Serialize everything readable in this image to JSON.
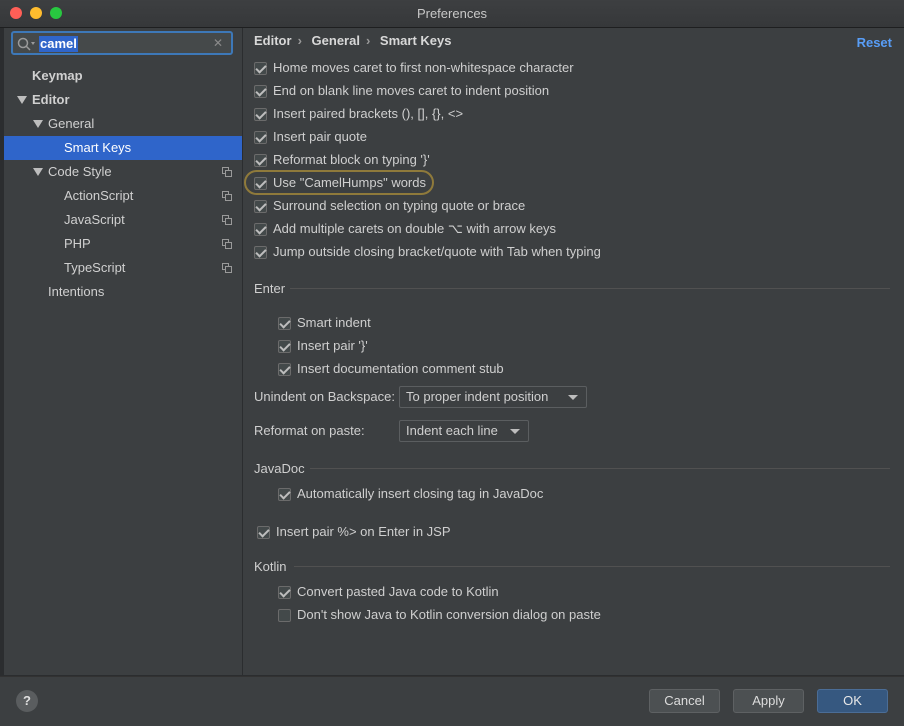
{
  "window": {
    "title": "Preferences",
    "colors": {
      "close": "#ff5f57",
      "minimize": "#febc2e",
      "zoom": "#28c840"
    }
  },
  "search": {
    "value": "camel"
  },
  "sidebar": {
    "items": [
      {
        "label": "Keymap"
      },
      {
        "label": "Editor"
      },
      {
        "label": "General"
      },
      {
        "label": "Smart Keys"
      },
      {
        "label": "Code Style"
      },
      {
        "label": "ActionScript"
      },
      {
        "label": "JavaScript"
      },
      {
        "label": "PHP"
      },
      {
        "label": "TypeScript"
      },
      {
        "label": "Intentions"
      }
    ]
  },
  "breadcrumb": {
    "items": [
      "Editor",
      "General",
      "Smart Keys"
    ],
    "separator": "›"
  },
  "reset_label": "Reset",
  "options": [
    {
      "label": "Home moves caret to first non-whitespace character",
      "checked": true
    },
    {
      "label": "End on blank line moves caret to indent position",
      "checked": true
    },
    {
      "label": "Insert paired brackets (), [], {}, <>",
      "checked": true
    },
    {
      "label": "Insert pair quote",
      "checked": true
    },
    {
      "label": "Reformat block on typing '}'",
      "checked": true
    },
    {
      "label": "Use \"CamelHumps\" words",
      "checked": true
    },
    {
      "label": "Surround selection on typing quote or brace",
      "checked": true
    },
    {
      "label": "Add multiple carets on double ⌥ with arrow keys",
      "checked": true
    },
    {
      "label": "Jump outside closing bracket/quote with Tab when typing",
      "checked": true
    }
  ],
  "enter": {
    "title": "Enter",
    "options": [
      {
        "label": "Smart indent",
        "checked": true
      },
      {
        "label": "Insert pair '}'",
        "checked": true
      },
      {
        "label": "Insert documentation comment stub",
        "checked": true
      }
    ],
    "unindent_label": "Unindent on Backspace:",
    "unindent_value": "To proper indent position",
    "reformat_label": "Reformat on paste:",
    "reformat_value": "Indent each line"
  },
  "javadoc": {
    "title": "JavaDoc",
    "options": [
      {
        "label": "Automatically insert closing tag in JavaDoc",
        "checked": true
      }
    ]
  },
  "jsp": {
    "label": "Insert pair %> on Enter in JSP",
    "checked": true
  },
  "kotlin": {
    "title": "Kotlin",
    "options": [
      {
        "label": "Convert pasted Java code to Kotlin",
        "checked": true
      },
      {
        "label": "Don't show Java to Kotlin conversion dialog on paste",
        "checked": false
      }
    ]
  },
  "footer": {
    "help": "?",
    "cancel": "Cancel",
    "apply": "Apply",
    "ok": "OK"
  }
}
